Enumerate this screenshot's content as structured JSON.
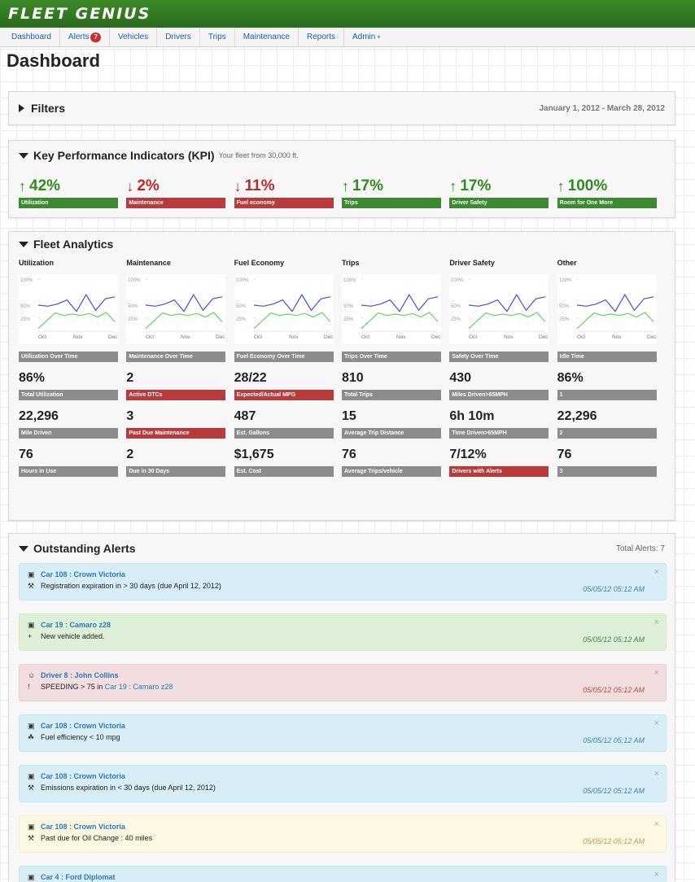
{
  "app": {
    "logo": "FLEET GENIUS"
  },
  "nav": {
    "items": [
      {
        "label": "Dashboard"
      },
      {
        "label": "Alerts",
        "badge": "7"
      },
      {
        "label": "Vehicles"
      },
      {
        "label": "Drivers"
      },
      {
        "label": "Trips"
      },
      {
        "label": "Maintenance"
      },
      {
        "label": "Reports"
      },
      {
        "label": "Admin",
        "caret": "▾"
      }
    ]
  },
  "page": {
    "title": "Dashboard"
  },
  "filters": {
    "title": "Filters",
    "date_range": "January 1, 2012 - March 28, 2012"
  },
  "kpi": {
    "title": "Key Performance Indicators (KPI)",
    "subtitle": "Your fleet from 30,000 ft.",
    "items": [
      {
        "value": "42%",
        "direction": "up",
        "label": "Utilization",
        "color": "#3c8a30"
      },
      {
        "value": "2%",
        "direction": "down",
        "label": "Maintenance",
        "color": "#b93a3a"
      },
      {
        "value": "11%",
        "direction": "down",
        "label": "Fuel economy",
        "color": "#b93a3a"
      },
      {
        "value": "17%",
        "direction": "up",
        "label": "Trips",
        "color": "#3c8a30"
      },
      {
        "value": "17%",
        "direction": "up",
        "label": "Driver Safety",
        "color": "#3c8a30"
      },
      {
        "value": "100%",
        "direction": "up",
        "label": "Room for One More",
        "color": "#3c8a30"
      }
    ]
  },
  "analytics": {
    "title": "Fleet Analytics",
    "chart_axis": {
      "y_ticks": [
        "100%",
        "50%",
        "25%"
      ],
      "x_ticks": [
        "Oct",
        "Nov",
        "Dec"
      ]
    },
    "columns": [
      {
        "title": "Utilization",
        "chart_label": "Utilization Over Time",
        "metrics": [
          {
            "value": "86%",
            "label": "Total Utilization",
            "tone": "gray"
          },
          {
            "value": "22,296",
            "label": "Mile Driven",
            "tone": "gray"
          },
          {
            "value": "76",
            "label": "Hours in Use",
            "tone": "gray"
          }
        ]
      },
      {
        "title": "Maintenance",
        "chart_label": "Maintenance Over Time",
        "metrics": [
          {
            "value": "2",
            "label": "Active DTCs",
            "tone": "red"
          },
          {
            "value": "3",
            "label": "Past Due Maintenance",
            "tone": "red"
          },
          {
            "value": "2",
            "label": "Due in 30 Days",
            "tone": "gray"
          }
        ]
      },
      {
        "title": "Fuel Economy",
        "chart_label": "Fuel Economy Over Time",
        "metrics": [
          {
            "value": "28/22",
            "label": "Expected/Actual MPG",
            "tone": "red"
          },
          {
            "value": "487",
            "label": "Est. Gallons",
            "tone": "gray"
          },
          {
            "value": "$1,675",
            "label": "Est. Cost",
            "tone": "gray"
          }
        ]
      },
      {
        "title": "Trips",
        "chart_label": "Trips Over Time",
        "metrics": [
          {
            "value": "810",
            "label": "Total Trips",
            "tone": "gray"
          },
          {
            "value": "15",
            "label": "Average Trip Distance",
            "tone": "gray"
          },
          {
            "value": "76",
            "label": "Average Trips/vehicle",
            "tone": "gray"
          }
        ]
      },
      {
        "title": "Driver Safety",
        "chart_label": "Safety Over Time",
        "metrics": [
          {
            "value": "430",
            "label": "Miles Driven>65MPH",
            "tone": "gray"
          },
          {
            "value": "6h 10m",
            "label": "Time Driven>65MPH",
            "tone": "gray"
          },
          {
            "value": "7/12%",
            "label": "Drivers with Alerts",
            "tone": "red"
          }
        ]
      },
      {
        "title": "Other",
        "chart_label": "Idle Time",
        "metrics": [
          {
            "value": "86%",
            "label": "1",
            "tone": "gray"
          },
          {
            "value": "22,296",
            "label": "2",
            "tone": "gray"
          },
          {
            "value": "76",
            "label": "3",
            "tone": "gray"
          }
        ]
      }
    ]
  },
  "alerts": {
    "title": "Outstanding Alerts",
    "total": "Total Alerts: 7",
    "close_glyph": "×",
    "items": [
      {
        "type": "info",
        "subject_icon": "car-icon",
        "subject": "Car 108 : Crown Victoria",
        "detail_icon": "wrench-icon",
        "detail": "Registration expiration in > 30 days (due April 12, 2012)",
        "time": "05/05/12 05:12 AM"
      },
      {
        "type": "success",
        "subject_icon": "car-icon",
        "subject": "Car 19 : Camaro z28",
        "detail_icon": "plus-icon",
        "detail": "New vehicle added.",
        "time": "05/05/12 05:12 AM"
      },
      {
        "type": "danger",
        "subject_icon": "user-icon",
        "subject": "Driver 8 : John Collins",
        "detail_icon": "alert-circle-icon",
        "detail_prefix": "SPEEDING > 75 in ",
        "detail_link": "Car 19 : Camaro z28",
        "time": "05/05/12 05:12 AM"
      },
      {
        "type": "info",
        "subject_icon": "car-icon",
        "subject": "Car 108 : Crown Victoria",
        "detail_icon": "leaf-icon",
        "detail": "Fuel efficiency < 10 mpg",
        "time": "05/05/12 05:12 AM"
      },
      {
        "type": "info",
        "subject_icon": "car-icon",
        "subject": "Car 108 : Crown Victoria",
        "detail_icon": "wrench-icon",
        "detail": "Emissions expiration in < 30 days (due April 12, 2012)",
        "time": "05/05/12 05:12 AM"
      },
      {
        "type": "warn",
        "subject_icon": "car-icon",
        "subject": "Car 108 : Crown Victoria",
        "detail_icon": "wrench-icon",
        "detail": "Past due for Oil Change : 40 miles",
        "time": "05/05/12 05:12 AM"
      },
      {
        "type": "info",
        "subject_icon": "car-icon",
        "subject": "Car 4 : Ford Diplomat",
        "detail_icon": "",
        "detail": "",
        "time": ""
      }
    ]
  }
}
